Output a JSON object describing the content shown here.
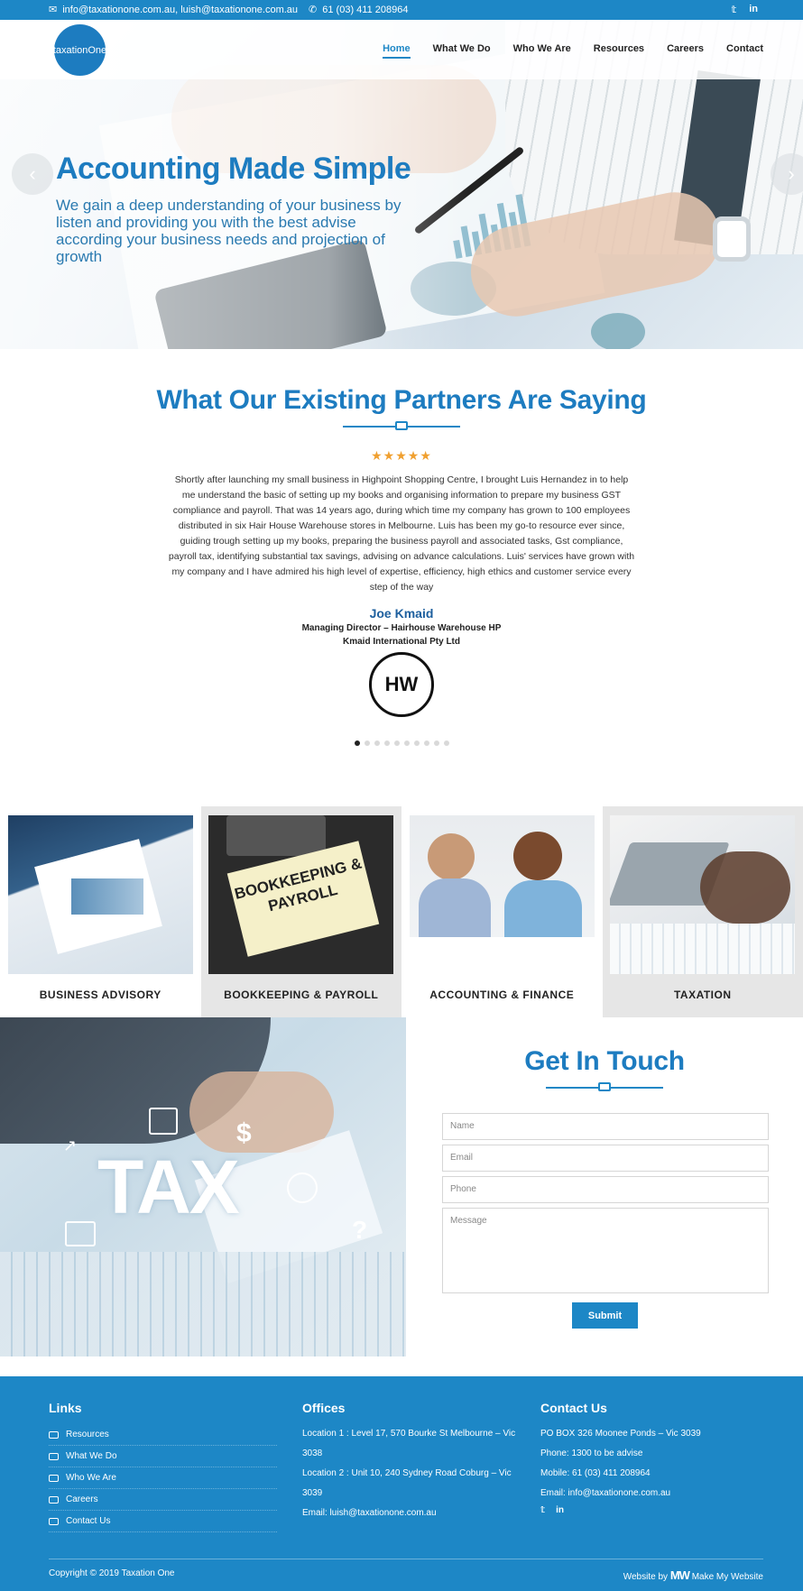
{
  "topbar": {
    "emails": "info@taxationone.com.au, luish@taxationone.com.au",
    "phone": "61 (03) 411 208964",
    "social": [
      "twitter-icon",
      "linkedin-icon"
    ]
  },
  "header": {
    "logo_text": "taxationOne",
    "nav": [
      "Home",
      "What We Do",
      "Who We Are",
      "Resources",
      "Careers",
      "Contact"
    ],
    "active": "Home"
  },
  "hero": {
    "title": "Accounting Made Simple",
    "subtitle": "We gain a deep understanding of your business by listen and providing you with the best advise according your business needs and projection of growth",
    "prev": "‹",
    "next": "›"
  },
  "testimonial": {
    "heading": "What Our Existing Partners Are Saying",
    "stars": "★★★★★",
    "rating": 5,
    "quote": "Shortly after launching my small business in Highpoint Shopping Centre, I brought Luis Hernandez in to help me understand the basic of setting up my books and organising information to prepare my business GST compliance and payroll. That was 14 years ago, during which time my company has grown to 100 employees distributed in six Hair House Warehouse stores in Melbourne. Luis has been my go-to resource ever since, guiding trough setting up my books, preparing the business payroll and associated tasks, Gst compliance, payroll tax, identifying substantial tax savings, advising on advance calculations. Luis' services have grown with my company and I have admired his high level of expertise, efficiency, high ethics and customer service every step of the way",
    "name": "Joe Kmaid",
    "role": "Managing Director – Hairhouse Warehouse HP",
    "company": "Kmaid International Pty Ltd",
    "logo_text": "HW",
    "slides": 10,
    "active_slide": 1
  },
  "services": [
    {
      "label": "BUSINESS ADVISORY"
    },
    {
      "label": "BOOKKEEPING & PAYROLL",
      "image_text": "BOOKKEEPING & PAYROLL"
    },
    {
      "label": "ACCOUNTING & FINANCE"
    },
    {
      "label": "TAXATION"
    }
  ],
  "contact_form": {
    "image_text": "TAX",
    "heading": "Get In Touch",
    "name_placeholder": "Name",
    "email_placeholder": "Email",
    "phone_placeholder": "Phone",
    "message_placeholder": "Message",
    "submit": "Submit"
  },
  "footer": {
    "links_title": "Links",
    "links": [
      "Resources",
      "What We Do",
      "Who We Are",
      "Careers",
      "Contact Us"
    ],
    "offices_title": "Offices",
    "offices": [
      "Location 1 : Level 17, 570 Bourke St Melbourne – Vic 3038",
      "Location 2 : Unit 10, 240 Sydney Road Coburg – Vic 3039",
      "Email: luish@taxationone.com.au"
    ],
    "contact_title": "Contact Us",
    "contact": [
      "PO BOX 326 Moonee Ponds – Vic 3039",
      "Phone: 1300 to be advise",
      "Mobile: 61 (03) 411 208964",
      "Email: info@taxationone.com.au"
    ],
    "copyright": "Copyright © 2019 Taxation One",
    "credit": "Website by",
    "credit_brand": "Make My Website"
  }
}
